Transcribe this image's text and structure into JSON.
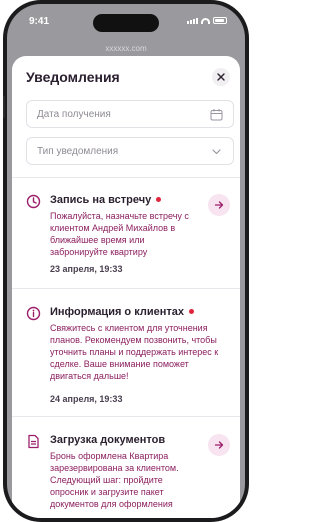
{
  "status": {
    "time": "9:41"
  },
  "browser": {
    "url": "xxxxxx.com"
  },
  "sheet": {
    "title": "Уведомления",
    "close_icon": "close-icon",
    "date_field": {
      "placeholder": "Дата получения",
      "icon": "calendar-icon"
    },
    "type_field": {
      "placeholder": "Тип уведомления",
      "icon": "chevron-down-icon"
    }
  },
  "notifications": [
    {
      "title": "Запись на встречу",
      "icon": "clock-icon",
      "unread": true,
      "body": "Пожалуйста, назначьте встречу с клиентом Андрей Михайлов в ближайшее время или забронируйте квартиру",
      "date": "23 апреля, 19:33"
    },
    {
      "title": "Информация о клиентах",
      "icon": "info-icon",
      "unread": true,
      "body": "Свяжитесь с клиентом для уточнения планов. Рекомендуем позвонить, чтобы уточнить планы и поддержать интерес к сделке. Ваше внимание поможет двигаться дальше!",
      "date": "24 апреля, 19:33"
    },
    {
      "title": "Загрузка документов",
      "icon": "document-icon",
      "unread": false,
      "body": "Бронь оформлена Квартира зарезервирована за клиентом. Следующий шаг: пройдите опросник и загрузите пакет документов для оформления",
      "date": ""
    }
  ],
  "colors": {
    "accent": "#9c1f6b",
    "unread_dot": "#e0243c",
    "title": "#2a1f2e"
  }
}
